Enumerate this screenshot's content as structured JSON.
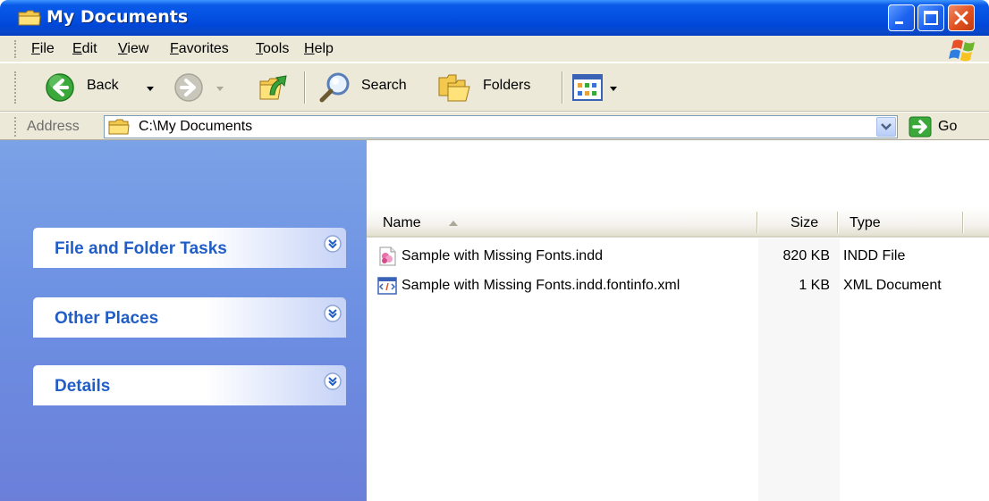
{
  "window": {
    "title": "My Documents",
    "icon": "folder-icon",
    "controls": [
      "minimize-icon",
      "maximize-icon",
      "close-icon"
    ]
  },
  "menu": {
    "items": [
      "File",
      "Edit",
      "View",
      "Favorites",
      "Tools",
      "Help"
    ]
  },
  "toolbar": {
    "back_label": "Back",
    "search_label": "Search",
    "folders_label": "Folders",
    "icons": [
      "back-arrow-icon",
      "forward-arrow-icon",
      "up-folder-icon",
      "search-icon",
      "folders-icon",
      "views-icon"
    ]
  },
  "address": {
    "label": "Address",
    "value": "C:\\My Documents",
    "go_label": "Go"
  },
  "task_pane": {
    "panels": [
      {
        "title": "File and Folder Tasks",
        "icon": "expand-chevron-icon"
      },
      {
        "title": "Other Places",
        "icon": "expand-chevron-icon"
      },
      {
        "title": "Details",
        "icon": "expand-chevron-icon"
      }
    ]
  },
  "file_list": {
    "columns": {
      "name": "Name",
      "size": "Size",
      "type": "Type"
    },
    "sort": {
      "column": "Name",
      "direction": "ascending"
    },
    "rows": [
      {
        "name": "Sample with Missing Fonts.indd",
        "size": "820 KB",
        "type": "INDD File",
        "icon": "indd-file-icon"
      },
      {
        "name": "Sample with Missing Fonts.indd.fontinfo.xml",
        "size": "1 KB",
        "type": "XML Document",
        "icon": "xml-file-icon"
      }
    ]
  },
  "colors": {
    "titlebar": "#0553e3",
    "chrome": "#ece9d8",
    "task_pane": "#6c8fe2",
    "task_title": "#215dc6",
    "close_button": "#e0501e"
  }
}
